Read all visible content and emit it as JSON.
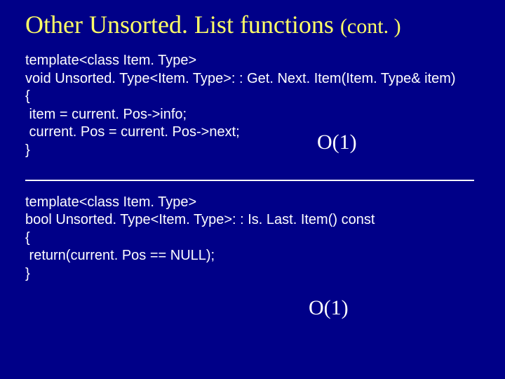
{
  "title": {
    "main": "Other Unsorted. List functions ",
    "cont": "(cont. )"
  },
  "block1": {
    "line1": "template<class Item. Type>",
    "line2": "void Unsorted. Type<Item. Type>: : Get. Next. Item(Item. Type& item)",
    "line3": "{",
    "line4": " item = current. Pos->info;",
    "line5": " current. Pos = current. Pos->next;",
    "line6": "}",
    "complexity": "O(1)"
  },
  "block2": {
    "line1": "template<class Item. Type>",
    "line2": "bool Unsorted. Type<Item. Type>: : Is. Last. Item() const",
    "line3": "{",
    "line4": " return(current. Pos == NULL);",
    "line5": "}",
    "complexity": "O(1)"
  }
}
